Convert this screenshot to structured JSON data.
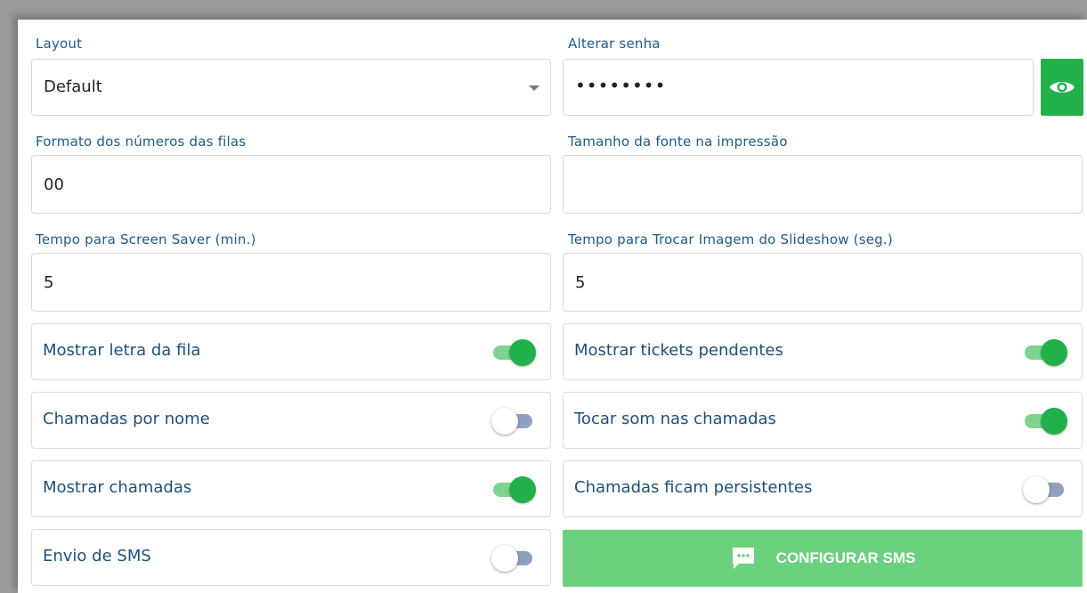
{
  "layout": {
    "label": "Layout",
    "value": "Default"
  },
  "password": {
    "label": "Alterar senha",
    "value": "••••••••",
    "reveal_icon": "eye-icon"
  },
  "queue_format": {
    "label": "Formato dos números das filas",
    "value": "00"
  },
  "font_size": {
    "label": "Tamanho da fonte na impressão",
    "value": ""
  },
  "screensaver": {
    "label": "Tempo para Screen Saver (min.)",
    "value": "5"
  },
  "slideshow": {
    "label": "Tempo para Trocar Imagem do Slideshow (seg.)",
    "value": "5"
  },
  "toggles": [
    {
      "label": "Mostrar letra da fila",
      "on": true
    },
    {
      "label": "Mostrar tickets pendentes",
      "on": true
    },
    {
      "label": "Chamadas por nome",
      "on": false
    },
    {
      "label": "Tocar som nas chamadas",
      "on": true
    },
    {
      "label": "Mostrar chamadas",
      "on": true
    },
    {
      "label": "Chamadas ficam persistentes",
      "on": false
    },
    {
      "label": "Envio de SMS",
      "on": false
    }
  ],
  "sms_button": {
    "label": "CONFIGURAR SMS",
    "icon": "chat-bubble-icon"
  },
  "colors": {
    "accent": "#22b04b",
    "accent_light": "#6cd17f",
    "label": "#1f5a87"
  }
}
